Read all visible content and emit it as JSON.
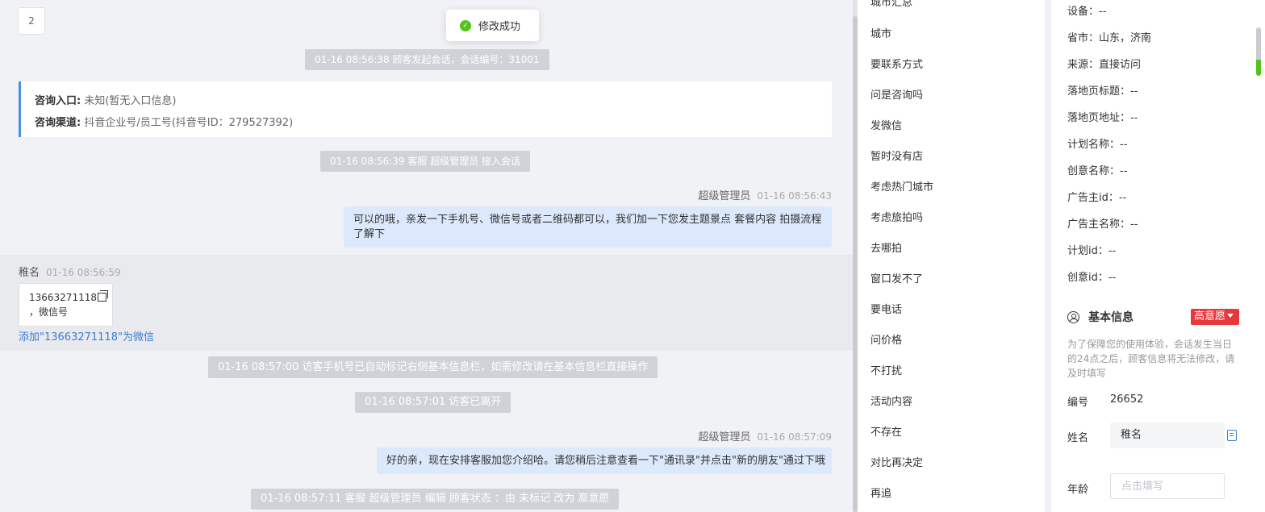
{
  "chat": {
    "page_number": "2",
    "toast": "修改成功",
    "sys_start": "01-16 08:56:38 顾客发起会话，会话编号：31001",
    "consult_entry_label": "咨询入口:",
    "consult_entry_value": "未知(暂无入口信息)",
    "consult_channel_label": "咨询渠道:",
    "consult_channel_value": "抖音企业号/员工号(抖音号ID：279527392)",
    "sys_accept": "01-16 08:56:39 客服 超级管理员 接入会话",
    "agent_name": "超级管理员",
    "msg1_time": "01-16 08:56:43",
    "msg1_line1": "可以的哦，亲发一下手机号、微信号或者二维码都可以，我们加一下您发主题景点 套餐内容 拍摄流程",
    "msg1_line2": "了解下",
    "visitor_name": "稚名",
    "visitor_time": "01-16 08:56:59",
    "visitor_phone": "13663271118",
    "visitor_suffix": "，微信号",
    "add_wechat": "添加\"13663271118\"为微信",
    "sys_mark": "01-16 08:57:00 访客手机号已自动标记右侧基本信息栏，如需修改请在基本信息栏直接操作",
    "sys_leave": "01-16 08:57:01 访客已离开",
    "msg2_time": "01-16 08:57:09",
    "msg2_text": "好的亲，现在安排客服加您介绍哈。请您稍后注意查看一下\"通讯录\"并点击\"新的朋友\"通过下哦",
    "sys_edit": "01-16 08:57:11 客服 超级管理员 编辑 顾客状态 ：由 未标记 改为 高意愿"
  },
  "phrases": [
    "城市汇总",
    "城市",
    "要联系方式",
    "问是咨询吗",
    "发微信",
    "暂时没有店",
    "考虑热门城市",
    "考虑旅拍吗",
    "去哪拍",
    "窗口发不了",
    "要电话",
    "问价格",
    "不打扰",
    "活动内容",
    "不存在",
    "对比再决定",
    "再追"
  ],
  "info": {
    "rows": [
      "设备：--",
      "省市：山东，济南",
      "来源：直接访问",
      "落地页标题：--",
      "落地页地址：--",
      "计划名称：--",
      "创意名称：--",
      "广告主id：--",
      "广告主名称：--",
      "计划id：--",
      "创意id：--"
    ],
    "section_title": "基本信息",
    "intent_tag": "高意愿",
    "notice": "为了保障您的使用体验，会话发生当日的24点之后，顾客信息将无法修改，请及时填写",
    "id_label": "编号",
    "id_value": "26652",
    "name_label": "姓名",
    "name_value": "稚名",
    "age_label": "年龄",
    "age_placeholder": "点击填写"
  }
}
